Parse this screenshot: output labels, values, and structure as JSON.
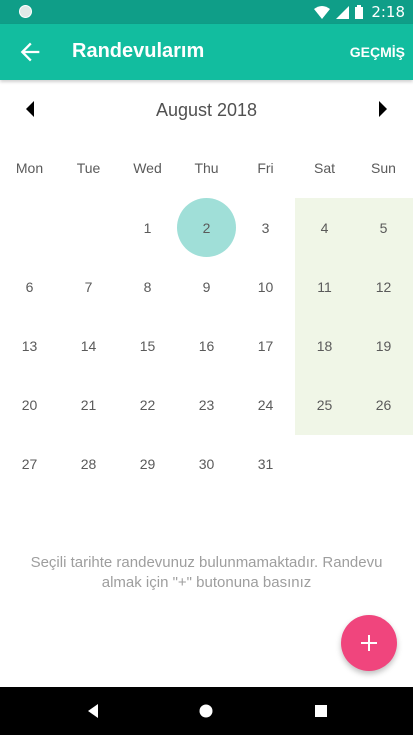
{
  "status_bar": {
    "time": "2:18"
  },
  "app_bar": {
    "title": "Randevularım",
    "history_label": "GEÇMİŞ"
  },
  "calendar": {
    "month_label": "August 2018",
    "weekdays": [
      "Mon",
      "Tue",
      "Wed",
      "Thu",
      "Fri",
      "Sat",
      "Sun"
    ],
    "weeks": [
      [
        "",
        "",
        "1",
        "2",
        "3",
        "4",
        "5"
      ],
      [
        "6",
        "7",
        "8",
        "9",
        "10",
        "11",
        "12"
      ],
      [
        "13",
        "14",
        "15",
        "16",
        "17",
        "18",
        "19"
      ],
      [
        "20",
        "21",
        "22",
        "23",
        "24",
        "25",
        "26"
      ],
      [
        "27",
        "28",
        "29",
        "30",
        "31",
        "",
        ""
      ]
    ],
    "selected_day": "2"
  },
  "empty_message": "Seçili tarihte randevunuz bulunmamaktadır. Randevu almak için \"+\" butonuna basınız",
  "colors": {
    "primary": "#12bd9f",
    "status_bar": "#0f9e88",
    "accent": "#f0457d",
    "selected": "#a0dfd8",
    "weekend_highlight": "#f0f6e7"
  }
}
